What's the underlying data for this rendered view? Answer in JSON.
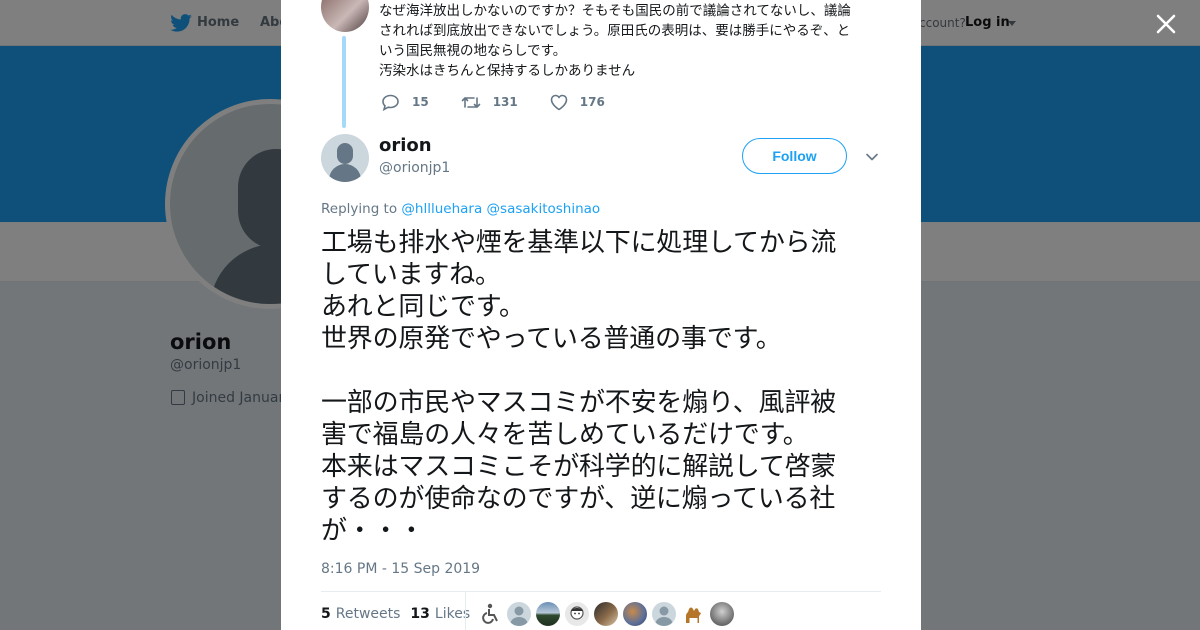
{
  "topbar": {
    "home_label": "Home",
    "about_label": "Abo",
    "account_question": "ccount?",
    "login_label": "Log in"
  },
  "profile": {
    "name": "orion",
    "handle": "@orionjp1",
    "joined": "Joined Januar"
  },
  "parent_tweet": {
    "text": "なぜ海洋放出しかないのですか？そもそも国民の前で議論されてないし、議論\nされれば到底放出できないでしょう。原田氏の表明は、要は勝手にやるぞ、と\nいう国民無視の地ならしです。\n汚染水はきちんと保持するしかありません",
    "replies": "15",
    "retweets": "131",
    "likes": "176"
  },
  "tweet": {
    "name": "orion",
    "handle": "@orionjp1",
    "follow_label": "Follow",
    "replying_prefix": "Replying to ",
    "replying_user1": "@hllluehara",
    "replying_user2": "@sasakitoshinao",
    "text": "工場も排水や煙を基準以下に処理してから流\nしていますね。\nあれと同じです。\n世界の原発でやっている普通の事です。\n\n一部の市民やマスコミが不安を煽り、風評被\n害で福島の人々を苦しめているだけです。\n本来はマスコミこそが科学的に解説して啓蒙\nするのが使命なのですが、逆に煽っている社\nが・・・",
    "timestamp": "8:16 PM - 15 Sep 2019",
    "retweet_count": "5",
    "retweets_label": "Retweets",
    "like_count": "13",
    "likes_label": "Likes"
  },
  "likers": [
    {
      "icon": "wheelchair-icon"
    },
    {
      "icon": "default-avatar"
    },
    {
      "icon": "landscape-avatar"
    },
    {
      "icon": "anime-avatar"
    },
    {
      "icon": "photo-avatar"
    },
    {
      "icon": "mosaic-avatar"
    },
    {
      "icon": "default-avatar"
    },
    {
      "icon": "camel-icon"
    },
    {
      "icon": "gray-photo-avatar"
    }
  ],
  "colors": {
    "brand": "#1da1f2",
    "text": "#14171a",
    "muted": "#657786",
    "thread": "#a4d9f9"
  }
}
